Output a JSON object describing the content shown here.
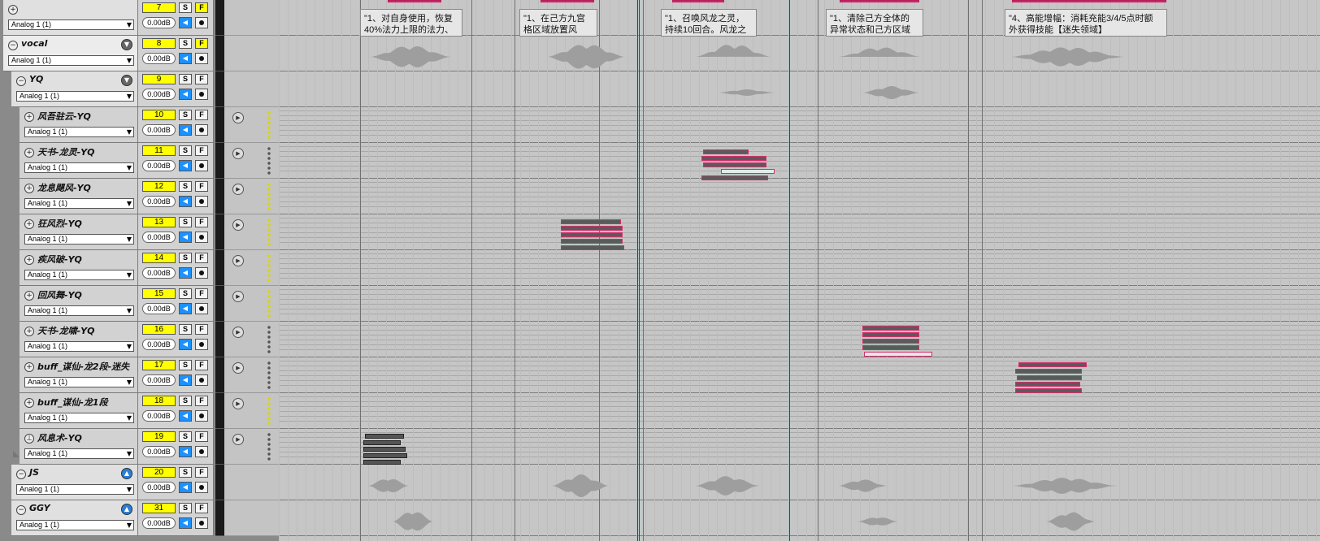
{
  "tracks": [
    {
      "number": "7",
      "name": "",
      "input": "Analog 1 (1)",
      "volume": "0.00dB",
      "solo": "S",
      "fx": "F",
      "fx_active": true,
      "expander": "+",
      "level": 0,
      "type": "folder"
    },
    {
      "number": "8",
      "name": "vocal",
      "input": "Analog 1 (1)",
      "volume": "0.00dB",
      "solo": "S",
      "fx": "F",
      "fx_active": true,
      "expander": "−",
      "level": 0,
      "type": "folder-vocal",
      "folder_icon": "▼"
    },
    {
      "number": "9",
      "name": "YQ",
      "input": "Analog 1 (1)",
      "volume": "0.00dB",
      "solo": "S",
      "fx": "F",
      "fx_active": false,
      "expander": "−",
      "level": 1,
      "type": "folder",
      "folder_icon": "▼"
    },
    {
      "number": "10",
      "name": "风吾驻云-YQ",
      "input": "Analog 1 (1)",
      "volume": "0.00dB",
      "solo": "S",
      "fx": "F",
      "fx_active": false,
      "expander": "+",
      "level": 2,
      "type": "midi",
      "dots": "yellow"
    },
    {
      "number": "11",
      "name": "天书-龙灵-YQ",
      "input": "Analog 1 (1)",
      "volume": "0.00dB",
      "solo": "S",
      "fx": "F",
      "fx_active": false,
      "expander": "+",
      "level": 2,
      "type": "midi",
      "dots": "gray"
    },
    {
      "number": "12",
      "name": "龙息飓风-YQ",
      "input": "Analog 1 (1)",
      "volume": "0.00dB",
      "solo": "S",
      "fx": "F",
      "fx_active": false,
      "expander": "+",
      "level": 2,
      "type": "midi",
      "dots": "yellow"
    },
    {
      "number": "13",
      "name": "狂风烈-YQ",
      "input": "Analog 1 (1)",
      "volume": "0.00dB",
      "solo": "S",
      "fx": "F",
      "fx_active": false,
      "expander": "+",
      "level": 2,
      "type": "midi",
      "dots": "yellow"
    },
    {
      "number": "14",
      "name": "疾风破-YQ",
      "input": "Analog 1 (1)",
      "volume": "0.00dB",
      "solo": "S",
      "fx": "F",
      "fx_active": false,
      "expander": "+",
      "level": 2,
      "type": "midi",
      "dots": "yellow"
    },
    {
      "number": "15",
      "name": "回风舞-YQ",
      "input": "Analog 1 (1)",
      "volume": "0.00dB",
      "solo": "S",
      "fx": "F",
      "fx_active": false,
      "expander": "+",
      "level": 2,
      "type": "midi",
      "dots": "yellow"
    },
    {
      "number": "16",
      "name": "天书-龙啸-YQ",
      "input": "Analog 1 (1)",
      "volume": "0.00dB",
      "solo": "S",
      "fx": "F",
      "fx_active": false,
      "expander": "+",
      "level": 2,
      "type": "midi",
      "dots": "gray"
    },
    {
      "number": "17",
      "name": "buff_谋仙-龙2段-迷失",
      "input": "Analog 1 (1)",
      "volume": "0.00dB",
      "solo": "S",
      "fx": "F",
      "fx_active": false,
      "expander": "+",
      "level": 2,
      "type": "midi",
      "dots": "gray"
    },
    {
      "number": "18",
      "name": "buff_谋仙-龙1段",
      "input": "Analog 1 (1)",
      "volume": "0.00dB",
      "solo": "S",
      "fx": "F",
      "fx_active": false,
      "expander": "+",
      "level": 2,
      "type": "midi",
      "dots": "yellow"
    },
    {
      "number": "19",
      "name": "风息术-YQ",
      "input": "Analog 1 (1)",
      "volume": "0.00dB",
      "solo": "S",
      "fx": "F",
      "fx_active": false,
      "expander": "⊥",
      "level": 2,
      "type": "midi",
      "dots": "gray"
    },
    {
      "number": "20",
      "name": "JS",
      "input": "Analog 1 (1)",
      "volume": "0.00dB",
      "solo": "S",
      "fx": "F",
      "fx_active": false,
      "expander": "−",
      "level": 1,
      "type": "folder",
      "folder_icon": "▲"
    },
    {
      "number": "31",
      "name": "GGY",
      "input": "Analog 1 (1)",
      "volume": "0.00dB",
      "solo": "S",
      "fx": "F",
      "fx_active": false,
      "expander": "−",
      "level": 1,
      "type": "folder",
      "folder_icon": "▲"
    }
  ],
  "text_items": [
    {
      "line1": "\"1、对自身使用，恢复",
      "line2": "40%法力上限的法力、"
    },
    {
      "line1": "\"1、在己方九宫",
      "line2": "格区域放置风"
    },
    {
      "line1": "\"1、召唤风龙之灵，",
      "line2": "持续10回合。风龙之"
    },
    {
      "line1": "\"1、清除己方全体的",
      "line2": "异常状态和己方区域"
    },
    {
      "line1": "\"4、高能增幅：消耗充能3/4/5点时额",
      "line2": "外获得技能【迷失领域】"
    }
  ],
  "icons": {
    "mute": "speaker-icon",
    "record": "record-arm-icon",
    "play": "play-icon",
    "dropdown": "dropdown-arrow-icon"
  },
  "colors": {
    "track_number_bg": "#ffff00",
    "mute_bg": "#1e90ff",
    "cursor": "#e00000",
    "midi_accent": "#d0306a"
  }
}
